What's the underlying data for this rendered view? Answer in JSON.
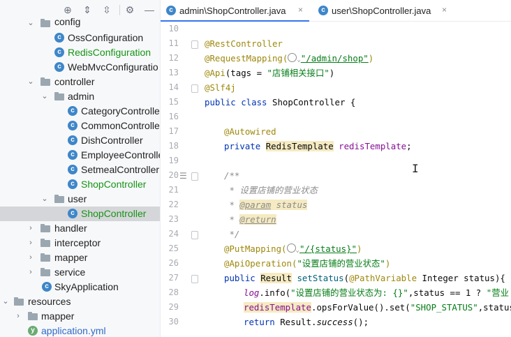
{
  "toolbar": {
    "icons": [
      "crosshair-icon",
      "expand-all-icon",
      "collapse-all-icon",
      "gear-icon",
      "minimize-icon"
    ],
    "glyphs": [
      "⊕",
      "⇕",
      "⇳",
      "⚙",
      "—"
    ]
  },
  "tree": {
    "rows": [
      {
        "label": "config",
        "type": "folder",
        "state": "expanded"
      },
      {
        "label": "OssConfiguration",
        "type": "class",
        "color": "normal"
      },
      {
        "label": "RedisConfiguration",
        "type": "class",
        "color": "green"
      },
      {
        "label": "WebMvcConfiguratio",
        "type": "class",
        "color": "normal"
      },
      {
        "label": "controller",
        "type": "folder",
        "state": "expanded"
      },
      {
        "label": "admin",
        "type": "folder",
        "state": "expanded"
      },
      {
        "label": "CategoryControlle",
        "type": "class",
        "color": "normal"
      },
      {
        "label": "CommonControlle",
        "type": "class",
        "color": "normal"
      },
      {
        "label": "DishController",
        "type": "class",
        "color": "normal"
      },
      {
        "label": "EmployeeControlle",
        "type": "class",
        "color": "normal"
      },
      {
        "label": "SetmealController",
        "type": "class",
        "color": "normal"
      },
      {
        "label": "ShopController",
        "type": "class",
        "color": "green"
      },
      {
        "label": "user",
        "type": "folder",
        "state": "expanded"
      },
      {
        "label": "ShopController",
        "type": "class",
        "color": "green",
        "selected": true
      },
      {
        "label": "handler",
        "type": "folder",
        "state": "collapsed"
      },
      {
        "label": "interceptor",
        "type": "folder",
        "state": "collapsed"
      },
      {
        "label": "mapper",
        "type": "folder",
        "state": "collapsed"
      },
      {
        "label": "service",
        "type": "folder",
        "state": "collapsed"
      },
      {
        "label": "SkyApplication",
        "type": "class",
        "color": "normal"
      },
      {
        "label": "resources",
        "type": "folder",
        "state": "expanded"
      },
      {
        "label": "mapper",
        "type": "folder",
        "state": "collapsed"
      },
      {
        "label": "application.yml",
        "type": "file",
        "color": "blue"
      }
    ]
  },
  "tabs": [
    {
      "label": "admin\\ShopController.java",
      "close": "×",
      "active": true
    },
    {
      "label": "user\\ShopController.java",
      "close": "×",
      "active": false
    }
  ],
  "editor": {
    "line_numbers": [
      "10",
      "11",
      "12",
      "13",
      "14",
      "15",
      "16",
      "17",
      "18",
      "19",
      "20",
      "21",
      "22",
      "23",
      "24",
      "25",
      "26",
      "27",
      "28",
      "29",
      "30"
    ],
    "gutter_icons": {
      "15": "bean-icon",
      "18": "bean-icon",
      "20": "doc-icon",
      "27": "bean-icon"
    },
    "code": {
      "l11": "@RestController",
      "l12_a": "@RequestMapping(",
      "l12_b": "\"/admin/shop\"",
      "l12_c": ")",
      "l13_a": "@Api",
      "l13_b": "(tags = ",
      "l13_c": "\"店铺相关接口\"",
      "l13_d": ")",
      "l14": "@Slf4j",
      "l15_a": "public class ",
      "l15_b": "ShopController {",
      "l17": "@Autowired",
      "l18_a": "private ",
      "l18_b": "RedisTemplate",
      "l18_c": " ",
      "l18_d": "redisTemplate",
      "l18_e": ";",
      "l20": "/**",
      "l21": " * 设置店铺的营业状态",
      "l22_a": " * ",
      "l22_b": "@param",
      "l22_c": " status",
      "l23_a": " * ",
      "l23_b": "@return",
      "l24": " */",
      "l25_a": "@PutMapping(",
      "l25_b": "\"/{status}\"",
      "l25_c": ")",
      "l26_a": "@ApiOperation(",
      "l26_b": "\"设置店铺的营业状态\"",
      "l26_c": ")",
      "l27_a": "public ",
      "l27_b": "Result",
      "l27_c": " ",
      "l27_d": "setStatus",
      "l27_e": "(",
      "l27_f": "@PathVariable",
      "l27_g": " Integer status){",
      "l28_a": "log",
      "l28_b": ".info(",
      "l28_c": "\"设置店铺的营业状态为: {}\"",
      "l28_d": ",status == 1 ? ",
      "l28_e": "\"营业",
      "l29_a": "redisTemplate",
      "l29_b": ".opsForValue().set(",
      "l29_c": "\"SHOP_STATUS\"",
      "l29_d": ",status);",
      "l30_a": "return ",
      "l30_b": "Result.",
      "l30_c": "success",
      "l30_d": "();"
    }
  },
  "cursor_glyph": "I",
  "colors": {
    "accent": "#3574f0",
    "vcs_added": "#159415",
    "annotation": "#9e880d",
    "keyword": "#0033b3",
    "string": "#067d17",
    "selection": "#d5d6d9"
  }
}
